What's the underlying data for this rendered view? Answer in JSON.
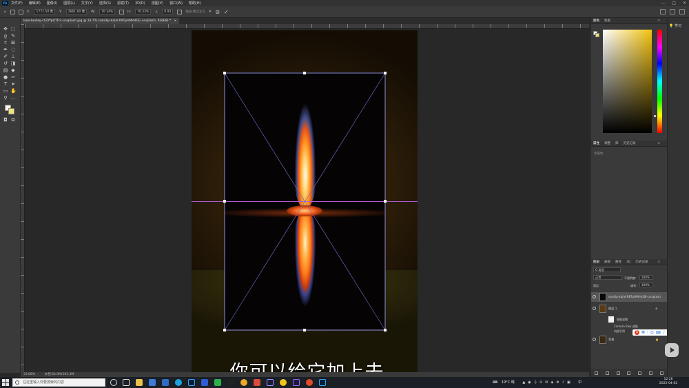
{
  "menubar": {
    "app_logo": "Ps",
    "items": [
      "文件(F)",
      "编辑(E)",
      "图像(I)",
      "图层(L)",
      "文字(Y)",
      "选择(S)",
      "滤镜(T)",
      "3D(D)",
      "视图(V)",
      "窗口(W)",
      "帮助(H)"
    ],
    "window_controls": [
      "—",
      "□",
      "✕"
    ]
  },
  "optionsbar": {
    "x_label": "X:",
    "x_value": "1771.50 像",
    "y_label": "Y:",
    "y_value": "2661.00 像",
    "w_label": "W:",
    "w_value": "70.34%",
    "h_label": "H:",
    "h_value": "70.33%",
    "angle_value": "0.00",
    "interp_label": "插值:两次立方",
    "warp_icon": "warp-icon",
    "cancel_icon": "cancel-transform-icon",
    "commit_icon": "commit-transform-icon"
  },
  "document": {
    "inactive_tab": "luke-besley-ch2YfpOTFrs-unsplash.jpg @ 33.7% (sandip-kalal-RKTpHMmtGE-unsplash, RGB/8) *",
    "close": "×"
  },
  "canvas": {
    "subtitle": "你可以给它加上去",
    "guide_color": "#b15ed2"
  },
  "statusbar": {
    "zoom": "33.68%",
    "doc_info": "文档:54.0M/103.3M"
  },
  "panels": {
    "color_tabs": [
      "颜色",
      "色板"
    ],
    "properties_tabs": [
      "属性",
      "调整",
      "库",
      "历史记录"
    ],
    "properties_empty": "无属性",
    "layers_tabs": [
      "图层",
      "通道",
      "路径",
      "3D",
      "历史记录"
    ],
    "layers_search": "Q 类型",
    "blend_mode": "正常",
    "opacity_label": "不透明度:",
    "opacity_value": "100%",
    "lock_label": "锁定:",
    "fill_label": "填充:",
    "fill_value": "100%",
    "layers": [
      {
        "name": "sandip-kalal-RKTpHMmtGE-unsplash",
        "selected": true
      },
      {
        "name": "图层 1",
        "selected": false
      },
      {
        "name": "背景",
        "selected": false
      }
    ],
    "smart_filters_label": "智能滤镜",
    "filter_items": [
      "Camera Raw 滤镜",
      "内部引用"
    ],
    "menu": "≡"
  },
  "ime": {
    "brand": "S",
    "items": [
      "英",
      "⁝",
      "☺",
      "⌨",
      "♪",
      "☰",
      "✦",
      "⊞"
    ]
  },
  "learn": {
    "label": "学习"
  },
  "taskbar": {
    "search_placeholder": "在这里输入你要搜索的内容",
    "weather": "19°C 晴",
    "input_method": "中",
    "time": "12:26",
    "date": "2022-04-02"
  },
  "colors": {
    "canvas_bg": "#282828",
    "panel_bg": "#3a3a3a",
    "accent": "#31a8ff"
  }
}
